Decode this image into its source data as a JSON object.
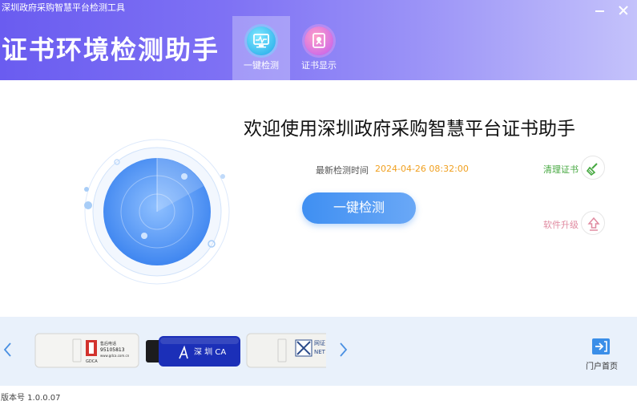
{
  "window": {
    "title": "深圳政府采购智慧平台检测工具"
  },
  "header": {
    "app_title": "证书环境检测助手",
    "tabs": [
      {
        "label": "一键检测",
        "icon": "monitor-check-icon",
        "active": true
      },
      {
        "label": "证书显示",
        "icon": "certificate-icon",
        "active": false
      }
    ]
  },
  "main": {
    "welcome": "欢迎使用深圳政府采购智慧平台证书助手",
    "last_check_label": "最新检测时间",
    "last_check_time": "2024-04-26 08:32:00",
    "detect_button": "一键检测",
    "clear_cert_label": "清理证书",
    "clear_cert_icon": "broom-icon",
    "upgrade_label": "软件升级",
    "upgrade_icon": "upload-arrow-icon"
  },
  "bottom": {
    "devices": [
      {
        "name": "device-gdca-key",
        "brand_text": "GDCA",
        "text": "售后电话\n95105813\nwww.gdca.com.cn"
      },
      {
        "name": "device-szca-key",
        "brand_text": "深 圳 CA"
      },
      {
        "name": "device-netca-key",
        "brand_text": "网证\nNET"
      }
    ],
    "portal_label": "门户首页",
    "portal_icon": "portal-login-icon"
  },
  "footer": {
    "version": "版本号 1.0.0.07"
  },
  "colors": {
    "header_start": "#6a5cf0",
    "header_end": "#c4c2fb",
    "primary_button": "#3f8ff2",
    "time_highlight": "#f0a020",
    "clear_green": "#46a840",
    "upgrade_pink": "#e08aa0",
    "bottom_bg": "#e9f1fb"
  }
}
